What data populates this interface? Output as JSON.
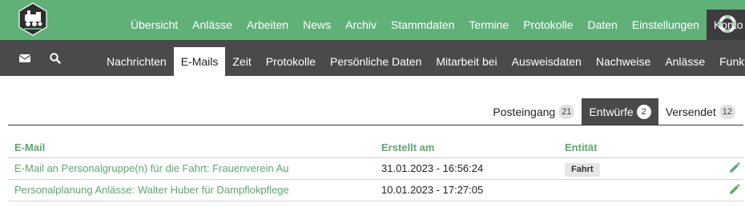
{
  "topnav": {
    "items": [
      "Übersicht",
      "Anlässe",
      "Arbeiten",
      "News",
      "Archiv",
      "Stammdaten",
      "Termine",
      "Protokolle",
      "Daten",
      "Einstellungen",
      "Konto"
    ],
    "active": "Konto"
  },
  "subnav": {
    "items": [
      "Nachrichten",
      "E-Mails",
      "Zeit",
      "Protokolle",
      "Persönliche Daten",
      "Mitarbeit bei",
      "Ausweisdaten",
      "Nachweise",
      "Anlässe",
      "Funktionen"
    ],
    "active": "E-Mails"
  },
  "mail_tabs": [
    {
      "label": "Posteingang",
      "count": "21"
    },
    {
      "label": "Entwürfe",
      "count": "2"
    },
    {
      "label": "Versendet",
      "count": "12"
    }
  ],
  "active_tab": "Entwürfe",
  "table": {
    "headers": {
      "email": "E-Mail",
      "created": "Erstellt am",
      "entity": "Entität"
    },
    "rows": [
      {
        "email": "E-Mail an Personalgruppe(n) für die Fahrt: Frauenverein Au",
        "created": "31.01.2023 - 16:56:24",
        "entity": "Fahrt"
      },
      {
        "email": "Personalplanung Anlässe: Walter Huber für Dampflokpflege",
        "created": "10.01.2023 - 17:27:05",
        "entity": ""
      }
    ]
  },
  "colors": {
    "brand_green": "#5fb178",
    "link_green": "#5aa86e",
    "dark_bar": "#4a4a4a"
  },
  "icons": {
    "logo": "locomotive-logo",
    "support": "lifebuoy-icon",
    "mail": "envelope-icon",
    "search": "search-icon",
    "edit": "pencil-icon"
  }
}
